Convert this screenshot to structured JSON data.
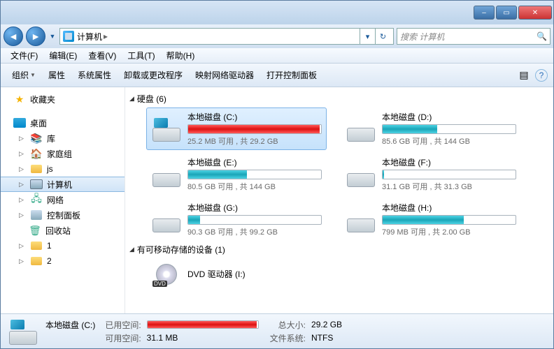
{
  "titlebar": {
    "min": "–",
    "max": "▭",
    "close": "✕"
  },
  "nav": {
    "back": "◄",
    "forward": "►",
    "path_root": "计算机",
    "refresh": "↻",
    "search_placeholder": "搜索 计算机",
    "search_icon": "🔍"
  },
  "menubar": [
    {
      "label": "文件(F)"
    },
    {
      "label": "编辑(E)"
    },
    {
      "label": "查看(V)"
    },
    {
      "label": "工具(T)"
    },
    {
      "label": "帮助(H)"
    }
  ],
  "toolbar": {
    "organize": "组织",
    "properties": "属性",
    "sysprops": "系统属性",
    "uninstall": "卸载或更改程序",
    "mapnet": "映射网络驱动器",
    "controlpanel": "打开控制面板",
    "view_icon": "▤",
    "help_icon": "?"
  },
  "sidebar": {
    "favorites": "收藏夹",
    "desktop": "桌面",
    "libraries": "库",
    "homegroup": "家庭组",
    "js": "js",
    "computer": "计算机",
    "network": "网络",
    "controlpanel": "控制面板",
    "recycle": "回收站",
    "folder1": "1",
    "folder2": "2"
  },
  "main": {
    "section_hdd": "硬盘 (6)",
    "section_removable": "有可移动存储的设备 (1)",
    "drives": [
      {
        "name": "本地磁盘 (C:)",
        "stats": "25.2 MB 可用 , 共 29.2 GB",
        "fill_pct": 99,
        "color": "red",
        "sys": true,
        "selected": true
      },
      {
        "name": "本地磁盘 (D:)",
        "stats": "85.6 GB 可用 , 共 144 GB",
        "fill_pct": 41,
        "color": "teal",
        "sys": false,
        "selected": false
      },
      {
        "name": "本地磁盘 (E:)",
        "stats": "80.5 GB 可用 , 共 144 GB",
        "fill_pct": 44,
        "color": "teal",
        "sys": false,
        "selected": false
      },
      {
        "name": "本地磁盘 (F:)",
        "stats": "31.1 GB 可用 , 共 31.3 GB",
        "fill_pct": 1,
        "color": "teal",
        "sys": false,
        "selected": false
      },
      {
        "name": "本地磁盘 (G:)",
        "stats": "90.3 GB 可用 , 共 99.2 GB",
        "fill_pct": 9,
        "color": "teal",
        "sys": false,
        "selected": false
      },
      {
        "name": "本地磁盘 (H:)",
        "stats": "799 MB 可用 , 共 2.00 GB",
        "fill_pct": 61,
        "color": "teal",
        "sys": false,
        "selected": false
      }
    ],
    "dvd": "DVD 驱动器 (I:)"
  },
  "status": {
    "name": "本地磁盘 (C:)",
    "used_lbl": "已用空间:",
    "free_lbl": "可用空间:",
    "free_val": "31.1 MB",
    "total_lbl": "总大小:",
    "total_val": "29.2 GB",
    "fs_lbl": "文件系统:",
    "fs_val": "NTFS",
    "fill_pct": 99
  }
}
